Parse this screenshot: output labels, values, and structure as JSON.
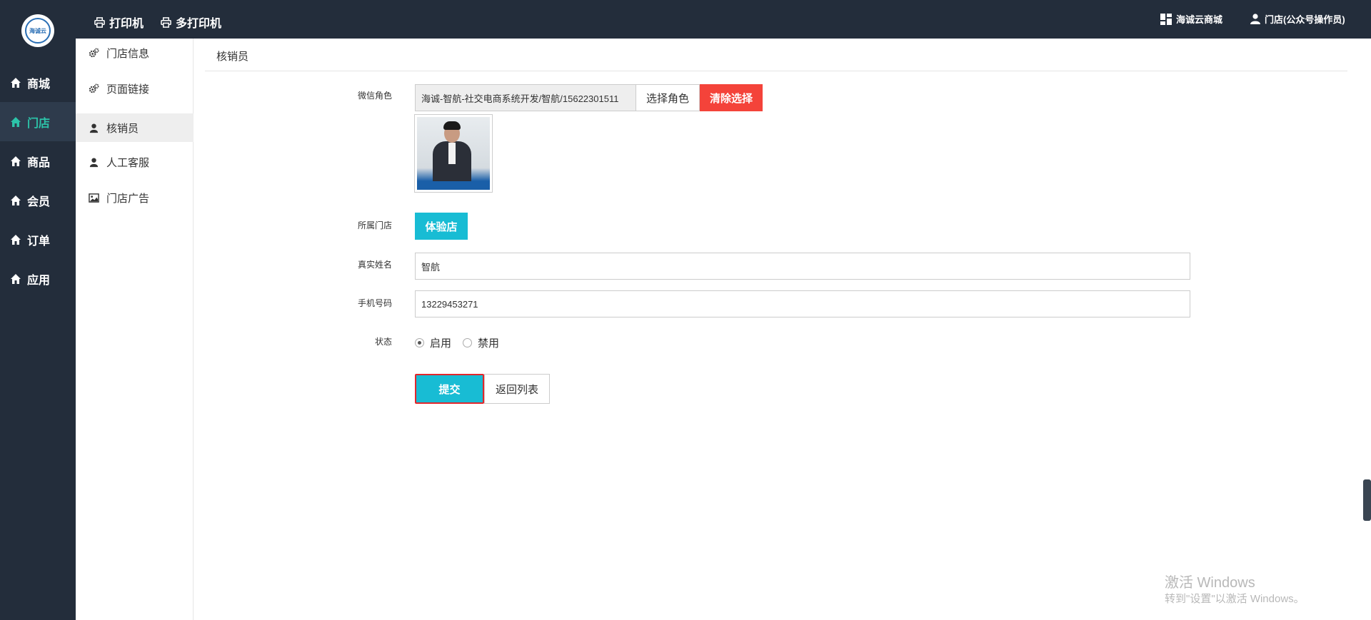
{
  "logo": {
    "text": "海诚云"
  },
  "topbar": {
    "printer": "打印机",
    "multi_printer": "多打印机",
    "store_mall": "海诚云商城",
    "user": "门店(公众号操作员)"
  },
  "sidebar": {
    "items": [
      {
        "label": "商城",
        "icon": "home-icon"
      },
      {
        "label": "门店",
        "icon": "home-icon"
      },
      {
        "label": "商品",
        "icon": "home-icon"
      },
      {
        "label": "会员",
        "icon": "home-icon"
      },
      {
        "label": "订单",
        "icon": "home-icon"
      },
      {
        "label": "应用",
        "icon": "home-icon"
      }
    ],
    "active_index": 1,
    "active_color": "#2cc3a9"
  },
  "subnav": {
    "items": [
      {
        "label": "门店信息",
        "icon": "cogs-icon"
      },
      {
        "label": "页面链接",
        "icon": "cogs-icon"
      },
      {
        "label": "核销员",
        "icon": "user-icon"
      },
      {
        "label": "人工客服",
        "icon": "user-icon"
      },
      {
        "label": "门店广告",
        "icon": "image-icon"
      }
    ],
    "active_index": 2
  },
  "main": {
    "title": "核销员",
    "form": {
      "wechat_label": "微信角色",
      "wechat_value": "海诚-智航-社交电商系统开发/智航/15622301511",
      "select_role_btn": "选择角色",
      "clear_btn": "清除选择",
      "store_label": "所属门店",
      "store_value": "体验店",
      "realname_label": "真实姓名",
      "realname_value": "智航",
      "phone_label": "手机号码",
      "phone_value": "13229453271",
      "status_label": "状态",
      "status_enable": "启用",
      "status_disable": "禁用",
      "status_selected": "启用",
      "submit_btn": "提交",
      "back_btn": "返回列表"
    }
  },
  "watermark": {
    "line1": "激活 Windows",
    "line2": "转到\"设置\"以激活 Windows。"
  },
  "colors": {
    "dark": "#232d3b",
    "accent": "#18bcd4",
    "danger": "#f4433a",
    "highlight_border": "#e3262b"
  }
}
